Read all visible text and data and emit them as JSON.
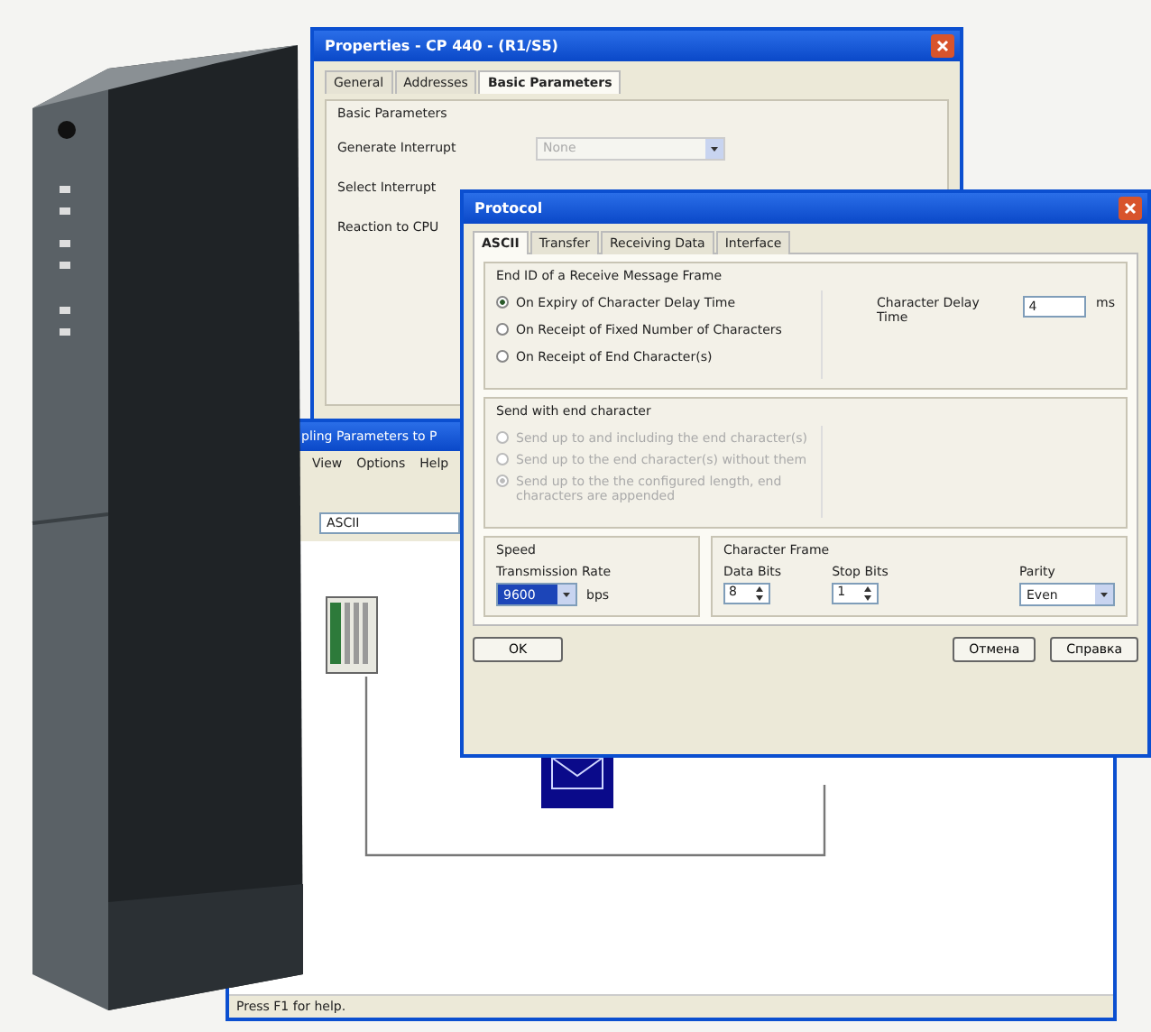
{
  "properties_window": {
    "title": "Properties - CP 440 - (R1/S5)",
    "tabs": [
      {
        "label": "General",
        "selected": false
      },
      {
        "label": "Addresses",
        "selected": false
      },
      {
        "label": "Basic Parameters",
        "selected": true
      }
    ],
    "group": "Basic Parameters",
    "rows": [
      {
        "label": "Generate Interrupt",
        "value": "None",
        "disabled": true
      },
      {
        "label": "Select Interrupt"
      },
      {
        "label": "Reaction to CPU"
      }
    ]
  },
  "back_window": {
    "title": "pling Parameters to P",
    "menu": [
      "View",
      "Options",
      "Help"
    ],
    "field": "ASCII",
    "status_bar": "Press F1 for help."
  },
  "protocol_dialog": {
    "title": "Protocol",
    "tabs": [
      {
        "label": "ASCII",
        "selected": true
      },
      {
        "label": "Transfer",
        "selected": false
      },
      {
        "label": "Receiving Data",
        "selected": false
      },
      {
        "label": "Interface",
        "selected": false
      }
    ],
    "end_id": {
      "title": "End ID of a Receive Message Frame",
      "options": [
        {
          "label": "On Expiry of Character Delay Time",
          "selected": true
        },
        {
          "label": "On Receipt of Fixed Number of Characters",
          "selected": false
        },
        {
          "label": "On Receipt of End Character(s)",
          "selected": false
        }
      ],
      "delay_label": "Character Delay Time",
      "delay_value": "4",
      "delay_unit": "ms"
    },
    "send_end": {
      "title": "Send with end character",
      "options": [
        {
          "label": "Send up to and including the end character(s)",
          "selected": false,
          "disabled": true
        },
        {
          "label": "Send up to the end character(s) without them",
          "selected": false,
          "disabled": true
        },
        {
          "label": "Send up to the the configured length, end characters are appended",
          "selected": true,
          "disabled": true
        }
      ]
    },
    "speed": {
      "title": "Speed",
      "label": "Transmission Rate",
      "value": "9600",
      "unit": "bps"
    },
    "frame": {
      "title": "Character Frame",
      "data_bits_label": "Data Bits",
      "data_bits": "8",
      "stop_bits_label": "Stop Bits",
      "stop_bits": "1",
      "parity_label": "Parity",
      "parity": "Even"
    },
    "buttons": [
      "OK",
      "Отмена",
      "Справка"
    ]
  }
}
